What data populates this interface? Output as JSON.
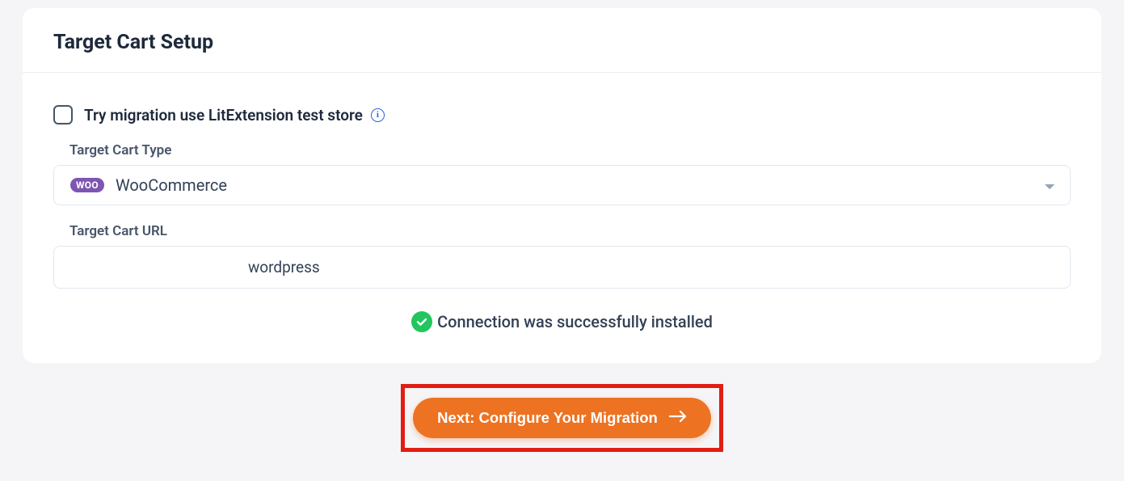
{
  "header": {
    "title": "Target Cart Setup"
  },
  "form": {
    "test_store_label": "Try migration use LitExtension test store",
    "cart_type_label": "Target Cart Type",
    "cart_type_value": "WooCommerce",
    "cart_type_badge": "WOO",
    "cart_url_label": "Target Cart URL",
    "cart_url_value": "wordpress"
  },
  "status": {
    "message": "Connection was successfully installed"
  },
  "actions": {
    "next_label": "Next: Configure Your Migration"
  }
}
